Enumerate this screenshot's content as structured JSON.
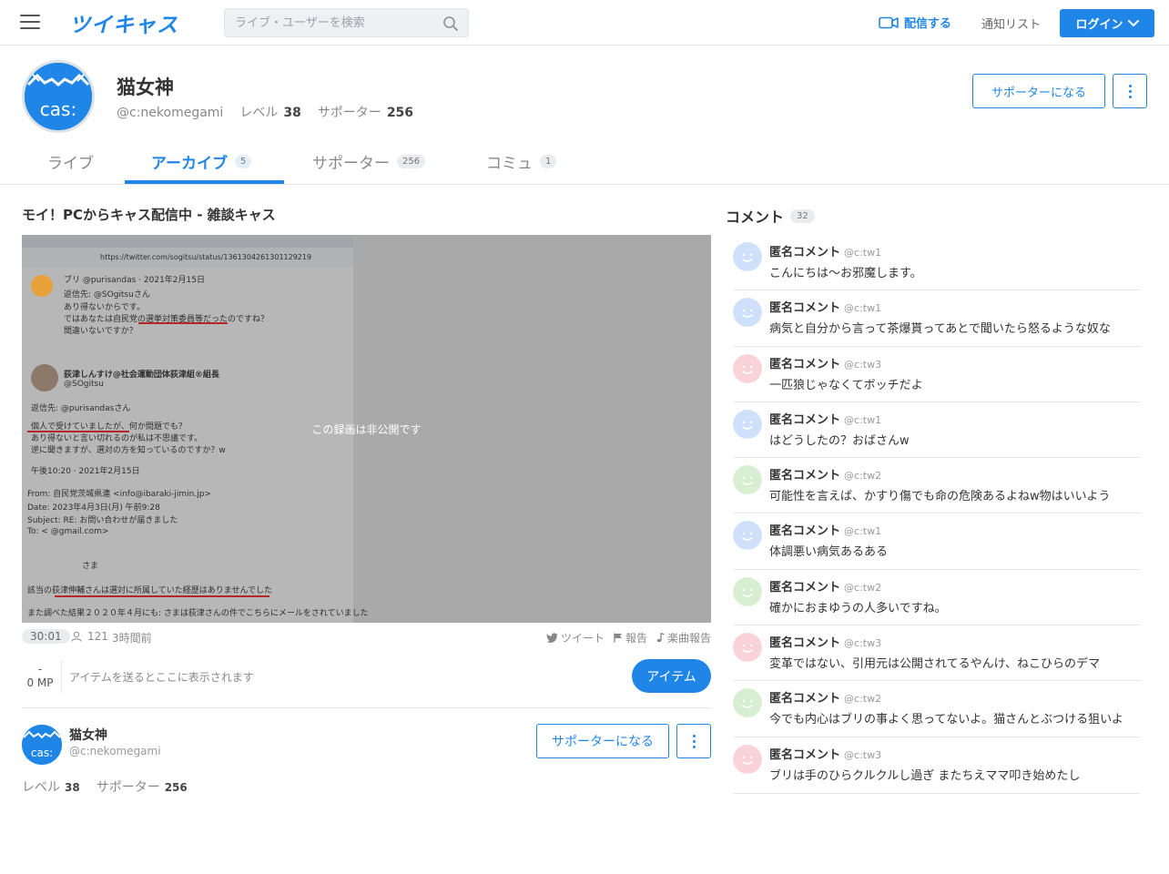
{
  "header": {
    "logo": "ツイキャス",
    "search_placeholder": "ライブ・ユーザーを検索",
    "broadcast_label": "配信する",
    "notify_label": "通知リスト",
    "login_label": "ログイン"
  },
  "profile": {
    "name": "猫女神",
    "user_id": "@c:nekomegami",
    "level_label": "レベル",
    "level": "38",
    "supporters_label": "サポーター",
    "supporters": "256",
    "support_button": "サポーターになる",
    "avatar_text": "cas:"
  },
  "tabs": [
    {
      "label": "ライブ",
      "count": ""
    },
    {
      "label": "アーカイブ",
      "count": "5"
    },
    {
      "label": "サポーター",
      "count": "256"
    },
    {
      "label": "コミュ",
      "count": "1"
    }
  ],
  "video": {
    "title": "モイ！PCからキャス配信中 - 雑談キャス",
    "private_notice": "この録画は非公開です",
    "duration": "30:01",
    "viewers": "121",
    "ago": "3時間前",
    "tweet_label": "ツイート",
    "report_label": "報告",
    "music_report_label": "楽曲報告",
    "screenshot": {
      "url": "https://twitter.com/sogitsu/status/1361304261301129219",
      "lines": [
        "ブリ @purisandas · 2021年2月15日",
        "返信先: @SOgitsuさん",
        "あり得ないからです。",
        "ではあなたは自民党の選挙対策委員等だったのですね？",
        "間違いないですか？",
        "荻津しんすけ@社会運動団体荻津組®組長",
        "@SOgitsu",
        "返信先: @purisandasさん",
        "個人で受けていましたが、何か問題でも？",
        "あり得ないと言い切れるのが私は不思議です。",
        "逆に聞きますが、選対の方を知っているのですか？w",
        "午後10:20 · 2021年2月15日",
        "From: 自民党茨城県連 <info@ibaraki-jimin.jp>",
        "Date: 2023年4月3日(月) 午前9:28",
        "Subject: RE: お問い合わせが届きました",
        "To:            <            @gmail.com>",
        "さま",
        "該当の荻津伸輔さんは選対に所属していた経歴はありませんでした",
        "また調べた結果２０２０年４月にも:      さまは荻津さんの件でこちらにメールをされていました"
      ]
    }
  },
  "items": {
    "mp_value": "-",
    "mp_label": "0 MP",
    "hint": "アイテムを送るとここに表示されます",
    "button": "アイテム"
  },
  "owner": {
    "name": "猫女神",
    "user_id": "@c:nekomegami",
    "level_label": "レベル",
    "level": "38",
    "supporters_label": "サポーター",
    "supporters": "256",
    "support_button": "サポーターになる"
  },
  "comments": {
    "title": "コメント",
    "count": "32",
    "items": [
      {
        "name": "匿名コメント",
        "id": "@c:tw1",
        "text": "こんにちは〜お邪魔します。",
        "color": "#cfe0fa"
      },
      {
        "name": "匿名コメント",
        "id": "@c:tw1",
        "text": "病気と自分から言って茶爆貰ってあとで聞いたら怒るような奴な",
        "color": "#cfe0fa"
      },
      {
        "name": "匿名コメント",
        "id": "@c:tw3",
        "text": "一匹狼じゃなくてボッチだよ",
        "color": "#f9d3d8"
      },
      {
        "name": "匿名コメント",
        "id": "@c:tw1",
        "text": "はどうしたの？おばさんw",
        "color": "#cfe0fa"
      },
      {
        "name": "匿名コメント",
        "id": "@c:tw2",
        "text": "可能性を言えば、かすり傷でも命の危険あるよねw物はいいよう",
        "color": "#d7efd0"
      },
      {
        "name": "匿名コメント",
        "id": "@c:tw1",
        "text": "体調悪い病気あるある",
        "color": "#cfe0fa"
      },
      {
        "name": "匿名コメント",
        "id": "@c:tw2",
        "text": "確かにおまゆうの人多いですね。",
        "color": "#d7efd0"
      },
      {
        "name": "匿名コメント",
        "id": "@c:tw3",
        "text": "変革ではない、引用元は公開されてるやんけ、ねこひらのデマ",
        "color": "#f9d3d8"
      },
      {
        "name": "匿名コメント",
        "id": "@c:tw2",
        "text": "今でも内心はブリの事よく思ってないよ。猫さんとぶつける狙いよ",
        "color": "#d7efd0"
      },
      {
        "name": "匿名コメント",
        "id": "@c:tw3",
        "text": "ブリは手のひらクルクルし過ぎ またちえママ叩き始めたし",
        "color": "#f9d3d8"
      }
    ]
  }
}
